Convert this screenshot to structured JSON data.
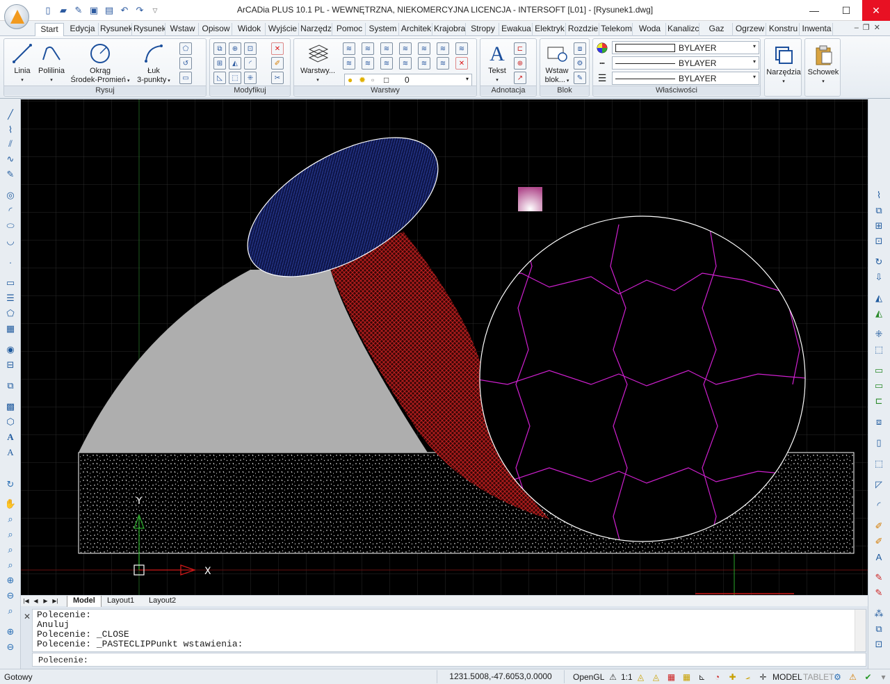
{
  "window": {
    "title": "ArCADia PLUS 10.1 PL - WEWNĘTRZNA, NIEKOMERCYJNA LICENCJA - INTERSOFT [L01] - [Rysunek1.dwg]"
  },
  "ribbon_tabs": [
    "Start",
    "Edycja",
    "Rysunek",
    "Rysunek",
    "Wstaw",
    "Opisow",
    "Widok",
    "Wyjście",
    "Narzędz",
    "Pomoc",
    "System",
    "Architek",
    "Krajobra",
    "Stropy",
    "Ewakua",
    "Elektryk",
    "Rozdzie",
    "Telekom",
    "Woda",
    "Kanalizc",
    "Gaz",
    "Ogrzew",
    "Konstru",
    "Inwenta"
  ],
  "ribbon": {
    "rysuj": {
      "label": "Rysuj",
      "linia": "Linia",
      "polilinia": "Polilinia",
      "okrag_1": "Okrąg",
      "okrag_2": "Środek-Promień",
      "luk_1": "Łuk",
      "luk_2": "3-punkty"
    },
    "modyfikuj": {
      "label": "Modyfikuj"
    },
    "warstwy": {
      "label": "Warstwy",
      "warstwy_btn": "Warstwy...",
      "layer_current": "0"
    },
    "adnotacja": {
      "label": "Adnotacja",
      "tekst": "Tekst"
    },
    "blok": {
      "label": "Blok",
      "wstaw_1": "Wstaw",
      "wstaw_2": "blok..."
    },
    "wlasciwosci": {
      "label": "Właściwości",
      "color": "BYLAYER",
      "linetype": "BYLAYER",
      "lineweight": "BYLAYER"
    },
    "narzedzia": "Narzędzia",
    "schowek": "Schowek"
  },
  "canvas": {
    "axis_x": "X",
    "axis_y": "Y"
  },
  "layout_tabs": [
    "Model",
    "Layout1",
    "Layout2"
  ],
  "command": {
    "history": [
      "Polecenie:",
      "Anuluj",
      "Polecenie: _CLOSE",
      "Polecenie: _PASTECLIPPunkt wstawienia:"
    ],
    "prompt": "Polecenie:"
  },
  "status": {
    "text": "Gotowy",
    "coords": "1231.5008,-47.6053,0.0000",
    "opengl": "OpenGL",
    "scale": "1:1",
    "model": "MODEL",
    "tablet": "TABLET"
  },
  "colors": {
    "canvas_bg": "#000000",
    "grid": "#2a2a2a",
    "ellipse_fill": "#0f1a5a",
    "red_hatch": "#b01818",
    "gray_fill": "#aeaeae",
    "magenta": "#d020d0"
  }
}
